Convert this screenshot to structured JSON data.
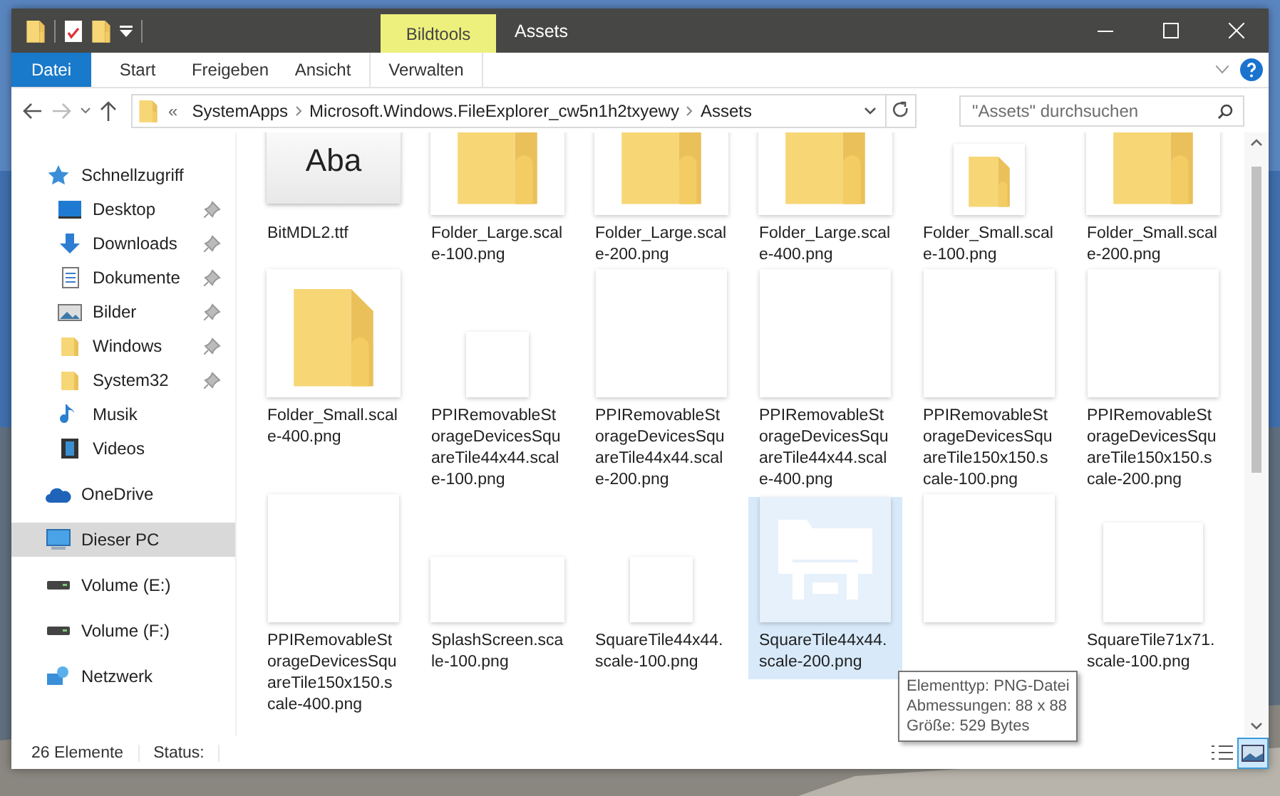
{
  "titlebar": {
    "context_tab": "Bildtools",
    "title": "Assets"
  },
  "ribbon": {
    "tabs": [
      {
        "label": "Datei",
        "kind": "file"
      },
      {
        "label": "Start",
        "kind": "tab"
      },
      {
        "label": "Freigeben",
        "kind": "tab"
      },
      {
        "label": "Ansicht",
        "kind": "tab"
      },
      {
        "label": "Verwalten",
        "kind": "context"
      }
    ]
  },
  "address": {
    "overflow": "«",
    "crumbs": [
      "SystemApps",
      "Microsoft.Windows.FileExplorer_cw5n1h2txyewy",
      "Assets"
    ]
  },
  "search": {
    "placeholder": "\"Assets\" durchsuchen"
  },
  "sidebar": {
    "items": [
      {
        "label": "Schnellzugriff",
        "kind": "star",
        "selected": false,
        "children": [
          {
            "label": "Desktop",
            "kind": "desktop",
            "pinned": true,
            "selected": false
          },
          {
            "label": "Downloads",
            "kind": "download",
            "pinned": true,
            "selected": false
          },
          {
            "label": "Dokumente",
            "kind": "document",
            "pinned": true,
            "selected": false
          },
          {
            "label": "Bilder",
            "kind": "pictures",
            "pinned": true,
            "selected": false
          },
          {
            "label": "Windows",
            "kind": "folder",
            "pinned": true,
            "selected": false
          },
          {
            "label": "System32",
            "kind": "folder",
            "pinned": true,
            "selected": false
          },
          {
            "label": "Musik",
            "kind": "music",
            "pinned": false,
            "selected": false
          },
          {
            "label": "Videos",
            "kind": "video",
            "pinned": false,
            "selected": false
          }
        ]
      },
      {
        "label": "OneDrive",
        "kind": "cloud",
        "selected": false
      },
      {
        "label": "Dieser PC",
        "kind": "pc",
        "selected": true
      },
      {
        "label": "Volume (E:)",
        "kind": "drive",
        "selected": false
      },
      {
        "label": "Volume (F:)",
        "kind": "drive",
        "selected": false
      },
      {
        "label": "Netzwerk",
        "kind": "network",
        "selected": false
      }
    ]
  },
  "files": [
    {
      "label": "BitMDL2.ttf",
      "kind": "font",
      "preview": "Aba",
      "selected": false
    },
    {
      "label": "Folder_Large.scale-100.png",
      "kind": "folder",
      "selected": false
    },
    {
      "label": "Folder_Large.scale-200.png",
      "kind": "folder",
      "selected": false
    },
    {
      "label": "Folder_Large.scale-400.png",
      "kind": "folder",
      "selected": false
    },
    {
      "label": "Folder_Small.scale-100.png",
      "kind": "smallfolder",
      "selected": false
    },
    {
      "label": "Folder_Small.scale-200.png",
      "kind": "folder",
      "selected": false
    },
    {
      "label": "Folder_Small.scale-400.png",
      "kind": "folder",
      "selected": false
    },
    {
      "label": "PPIRemovableStorageDevicesSquareTile44x44.scale-100.png",
      "kind": "smalltile",
      "selected": false
    },
    {
      "label": "PPIRemovableStorageDevicesSquareTile44x44.scale-200.png",
      "kind": "tile",
      "selected": false
    },
    {
      "label": "PPIRemovableStorageDevicesSquareTile44x44.scale-400.png",
      "kind": "tile",
      "selected": false
    },
    {
      "label": "PPIRemovableStorageDevicesSquareTile150x150.scale-100.png",
      "kind": "tile",
      "selected": false
    },
    {
      "label": "PPIRemovableStorageDevicesSquareTile150x150.scale-200.png",
      "kind": "tile",
      "selected": false
    },
    {
      "label": "PPIRemovableStorageDevicesSquareTile150x150.scale-400.png",
      "kind": "tile",
      "selected": false
    },
    {
      "label": "SplashScreen.scale-100.png",
      "kind": "widetile",
      "selected": false
    },
    {
      "label": "SquareTile44x44.scale-100.png",
      "kind": "smalltile",
      "selected": false
    },
    {
      "label": "SquareTile44x44.scale-200.png",
      "kind": "explorer",
      "selected": true
    },
    {
      "kind": "tile",
      "selected": false
    },
    {
      "label": "SquareTile71x71.scale-100.png",
      "kind": "mediumtile",
      "selected": false
    }
  ],
  "tooltip": [
    "Elementtyp: PNG-Datei",
    "Abmessungen: 88 x 88",
    "Größe: 529 Bytes"
  ],
  "status_bar": {
    "count": "26 Elemente",
    "status": "Status:",
    "views": [
      {
        "kind": "details",
        "selected": false
      },
      {
        "kind": "large",
        "selected": true
      }
    ]
  }
}
